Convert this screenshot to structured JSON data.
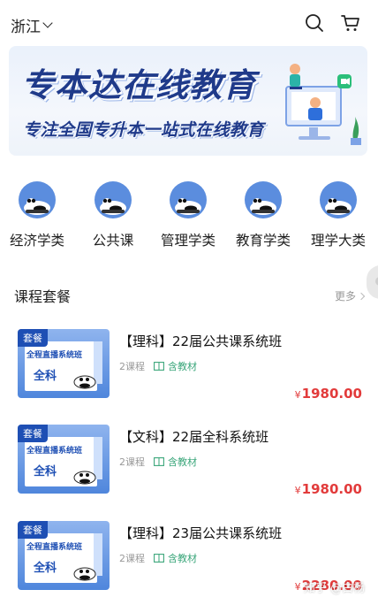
{
  "header": {
    "region": "浙江",
    "search_icon": "search-icon",
    "cart_icon": "cart-icon"
  },
  "banner": {
    "title": "专本达在线教育",
    "subtitle": "专注全国专升本一站式在线教育"
  },
  "categories": [
    {
      "label": "经济学类",
      "icon": "panda-icon"
    },
    {
      "label": "公共课",
      "icon": "panda-icon"
    },
    {
      "label": "管理学类",
      "icon": "panda-icon"
    },
    {
      "label": "教育学类",
      "icon": "panda-icon"
    },
    {
      "label": "理学大类",
      "icon": "panda-icon"
    }
  ],
  "section": {
    "title": "课程套餐",
    "more": "更多"
  },
  "courses": [
    {
      "tag": "套餐",
      "thumb_line1": "全程直播系统班",
      "thumb_line2": "全科",
      "title": "【理科】22届公共课系统班",
      "lessons": "2课程",
      "material": "含教材",
      "currency": "¥",
      "price": "1980.00"
    },
    {
      "tag": "套餐",
      "thumb_line1": "全程直播系统班",
      "thumb_line2": "全科",
      "title": "【文科】22届全科系统班",
      "lessons": "2课程",
      "material": "含教材",
      "currency": "¥",
      "price": "1980.00"
    },
    {
      "tag": "套餐",
      "thumb_line1": "全程直播系统班",
      "thumb_line2": "全科",
      "title": "【理科】23届公共课系统班",
      "lessons": "2课程",
      "material": "含教材",
      "currency": "¥",
      "price": "2280.00"
    }
  ],
  "watermark": "知乎 @白杨",
  "colors": {
    "brand_blue": "#1f3a8a",
    "price_red": "#e23b3b",
    "material_green": "#3aa67a",
    "icon_blue": "#5b8dde"
  }
}
